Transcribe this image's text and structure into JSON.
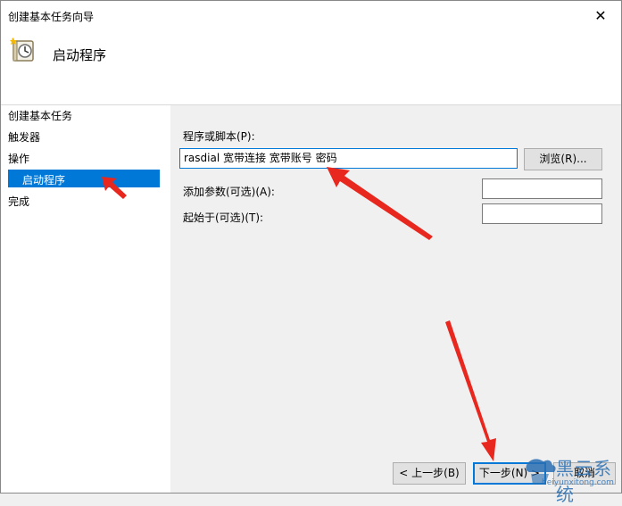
{
  "window": {
    "title": "创建基本任务向导",
    "close_glyph": "✕"
  },
  "header": {
    "title": "启动程序",
    "icon": "clock-scroll-icon"
  },
  "sidebar": {
    "items": [
      {
        "label": "创建基本任务"
      },
      {
        "label": "触发器"
      },
      {
        "label": "操作"
      },
      {
        "label": "启动程序",
        "selected": true
      },
      {
        "label": "完成"
      }
    ]
  },
  "form": {
    "program_label": "程序或脚本(P):",
    "program_value": "rasdial 宽带连接 宽带账号  密码",
    "browse_label": "浏览(R)...",
    "args_label": "添加参数(可选)(A):",
    "args_value": "",
    "startin_label": "起始于(可选)(T):",
    "startin_value": ""
  },
  "footer": {
    "back_label": "< 上一步(B)",
    "next_label": "下一步(N) >",
    "cancel_label": "取消"
  },
  "watermark": {
    "brand": "黑云系统",
    "url": "heiyunxitong.com"
  },
  "colors": {
    "accent": "#0078d7",
    "arrow": "#e8271e"
  }
}
